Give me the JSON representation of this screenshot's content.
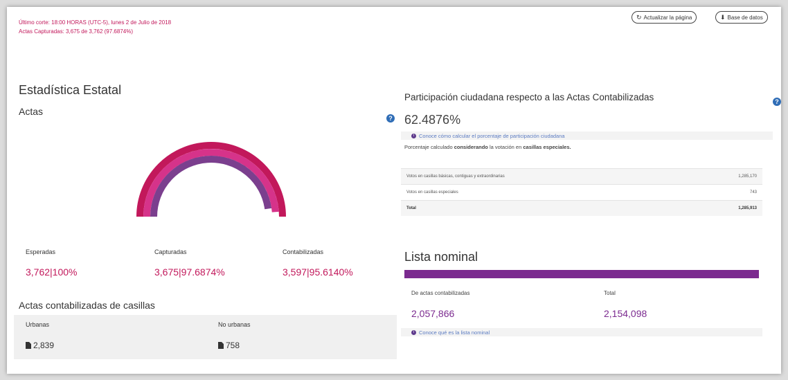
{
  "header": {
    "line1": "Último corte: 18:00 HORAS (UTC-5), lunes 2 de Julio de 2018",
    "line2": "Actas Capturadas: 3,675 de 3,762 (97.6874%)",
    "refresh_label": "Actualizar la página",
    "database_label": "Base de datos"
  },
  "estadistica": {
    "title": "Estadística Estatal",
    "actas_title": "Actas",
    "arcs": [
      {
        "name": "Esperadas",
        "fraction": 1.0,
        "color": "#c2185b"
      },
      {
        "name": "Capturadas",
        "fraction": 0.976874,
        "color": "#d6338a"
      },
      {
        "name": "Contabilizadas",
        "fraction": 0.95614,
        "color": "#7b3f8e"
      }
    ],
    "stats": [
      {
        "label": "Esperadas",
        "value": "3,762|100%"
      },
      {
        "label": "Capturadas",
        "value": "3,675|97.6874%"
      },
      {
        "label": "Contabilizadas",
        "value": "3,597|95.6140%"
      }
    ]
  },
  "casillas": {
    "title": "Actas contabilizadas de casillas",
    "urbanas_label": "Urbanas",
    "urbanas_value": "2,839",
    "no_urbanas_label": "No urbanas",
    "no_urbanas_value": "758"
  },
  "participacion": {
    "title": "Participación ciudadana respecto a las Actas Contabilizadas",
    "percent": "62.4876%",
    "info_link": "Conoce cómo calcular el porcentaje de participación ciudadana",
    "note_pre": "Porcentaje calculado ",
    "note_bold1": "considerando",
    "note_mid": " la votación en ",
    "note_bold2": "casillas especiales.",
    "rows": [
      {
        "label": "Votos en casillas básicas, contiguas y extraordinarias",
        "value": "1,285,170"
      },
      {
        "label": "Votos en casillas especiales",
        "value": "743"
      },
      {
        "label": "Total",
        "value": "1,285,913"
      }
    ]
  },
  "lista": {
    "title": "Lista nominal",
    "fill_fraction": 1.0,
    "de_actas_label": "De actas contabilizadas",
    "total_label": "Total",
    "de_actas_value": "2,057,866",
    "total_value": "2,154,098",
    "info_link": "Conoce qué es la lista nominal"
  }
}
